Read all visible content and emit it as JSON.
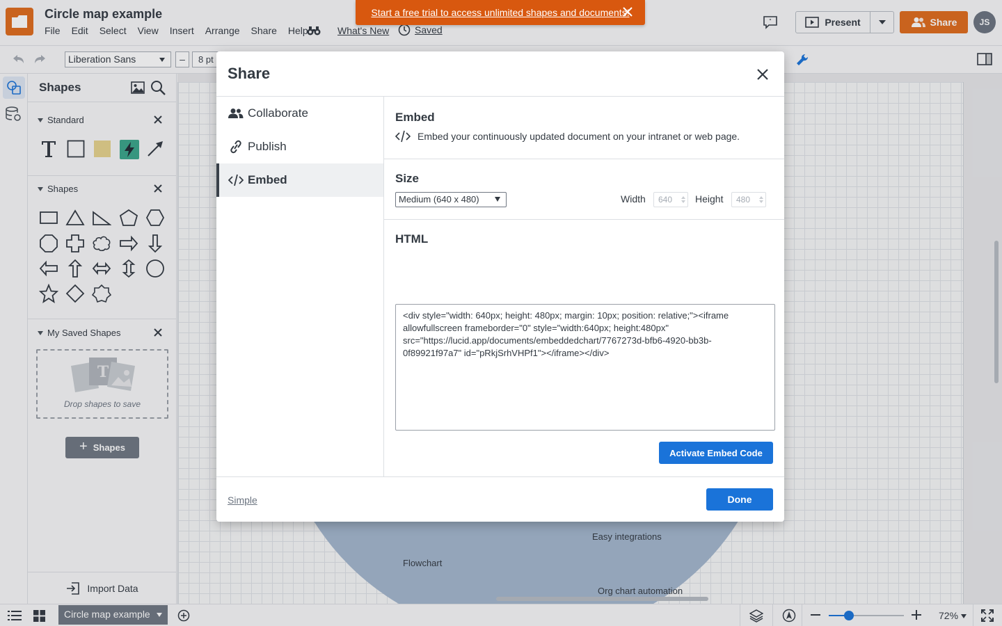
{
  "app": {
    "doc_title": "Circle map example",
    "brand_color": "#e06c1c",
    "accent_color": "#1a73d9"
  },
  "menu": [
    "File",
    "Edit",
    "Select",
    "View",
    "Insert",
    "Arrange",
    "Share",
    "Help"
  ],
  "header": {
    "find_icon": "binoculars-icon",
    "whats_new": "What's New",
    "saved": "Saved",
    "trial_banner": "Start a free trial to access unlimited shapes and documents!",
    "present": "Present",
    "share": "Share",
    "avatar_initials": "JS"
  },
  "toolbar": {
    "font": "Liberation Sans",
    "font_size": "8 pt",
    "size_minus": "–"
  },
  "shapes_panel": {
    "title": "Shapes",
    "sections": {
      "standard": "Standard",
      "shapes": "Shapes",
      "saved": "My Saved Shapes"
    },
    "saved_hint": "Drop shapes to save",
    "add_button": "Shapes",
    "add_plus": "+",
    "import_data": "Import Data"
  },
  "canvas": {
    "labels": [
      "Easy integrations",
      "Flowchart",
      "Org chart automation"
    ]
  },
  "bottom": {
    "page_tab": "Circle map example",
    "zoom": "72%",
    "zoom_fraction": 0.27
  },
  "modal": {
    "title": "Share",
    "nav": [
      {
        "label": "Collaborate",
        "icon": "people-icon"
      },
      {
        "label": "Publish",
        "icon": "link-icon"
      },
      {
        "label": "Embed",
        "icon": "code-icon"
      }
    ],
    "active_tab": "Embed",
    "embed": {
      "heading": "Embed",
      "description": "Embed your continuously updated document on your intranet or web page.",
      "size_heading": "Size",
      "size_option": "Medium (640 x 480)",
      "width_label": "Width",
      "width_value": "640",
      "height_label": "Height",
      "height_value": "480",
      "html_heading": "HTML",
      "html_code": "<div style=\"width: 640px; height: 480px; margin: 10px; position: relative;\"><iframe allowfullscreen frameborder=\"0\" style=\"width:640px; height:480px\" src=\"https://lucid.app/documents/embeddedchart/7767273d-bfb6-4920-bb3b-0f89921f97a7\" id=\"pRkjSrhVHPf1\"></iframe></div>",
      "activate_button": "Activate Embed Code"
    },
    "simple_link": "Simple",
    "done_button": "Done"
  }
}
